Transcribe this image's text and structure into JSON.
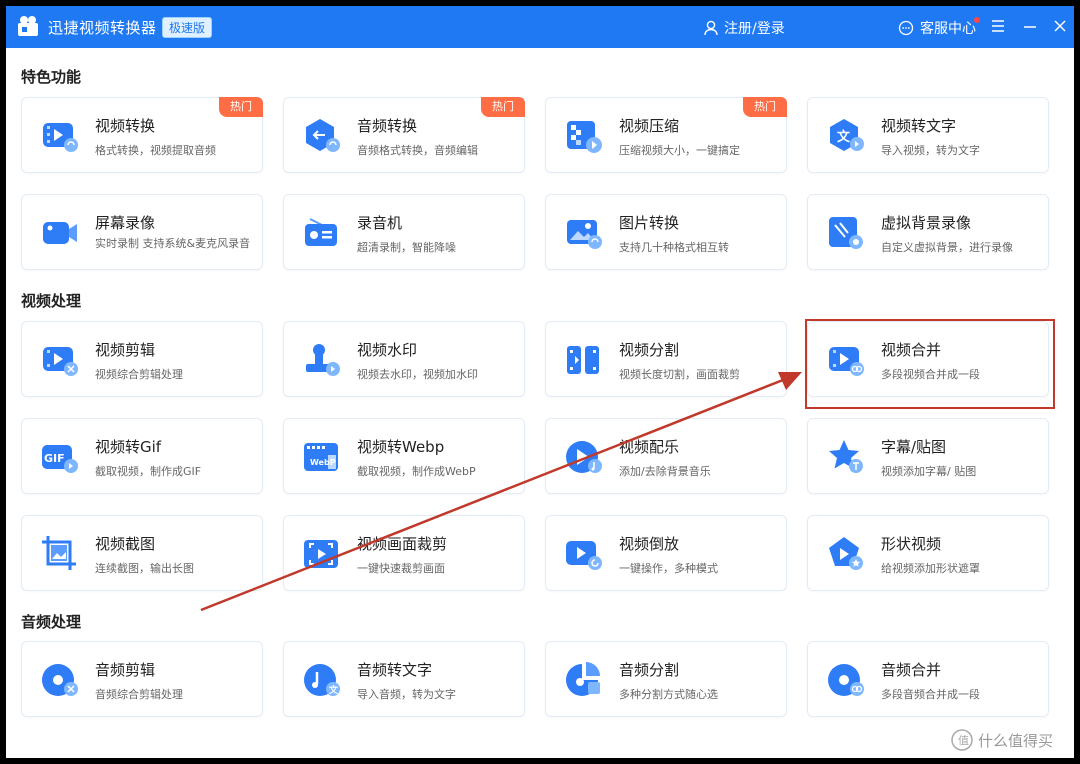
{
  "window": {
    "app_title": "迅捷视频转换器",
    "edition_badge": "极速版",
    "login_label": "注册/登录",
    "service_label": "客服中心"
  },
  "sections": [
    {
      "title": "特色功能"
    },
    {
      "title": "视频处理"
    },
    {
      "title": "音频处理"
    }
  ],
  "hot_label": "热门",
  "cards": [
    {
      "title": "视频转换",
      "subtitle": "格式转换，视频提取音频",
      "icon": "video-convert-icon"
    },
    {
      "title": "音频转换",
      "subtitle": "音频格式转换，音频编辑",
      "icon": "audio-convert-icon"
    },
    {
      "title": "视频压缩",
      "subtitle": "压缩视频大小，一键搞定",
      "icon": "video-compress-icon"
    },
    {
      "title": "视频转文字",
      "subtitle": "导入视频，转为文字",
      "icon": "video-to-text-icon"
    },
    {
      "title": "屏幕录像",
      "subtitle": "实时录制 支持系统&麦克风录音",
      "icon": "screen-record-icon"
    },
    {
      "title": "录音机",
      "subtitle": "超清录制，智能降噪",
      "icon": "recorder-icon"
    },
    {
      "title": "图片转换",
      "subtitle": "支持几十种格式相互转",
      "icon": "image-convert-icon"
    },
    {
      "title": "虚拟背景录像",
      "subtitle": "自定义虚拟背景，进行录像",
      "icon": "virtual-bg-icon"
    },
    {
      "title": "视频剪辑",
      "subtitle": "视频综合剪辑处理",
      "icon": "video-edit-icon"
    },
    {
      "title": "视频水印",
      "subtitle": "视频去水印，视频加水印",
      "icon": "watermark-icon"
    },
    {
      "title": "视频分割",
      "subtitle": "视频长度切割，画面裁剪",
      "icon": "video-split-icon"
    },
    {
      "title": "视频合并",
      "subtitle": "多段视频合并成一段",
      "icon": "video-merge-icon"
    },
    {
      "title": "视频转Gif",
      "subtitle": "截取视频，制作成GIF",
      "icon": "gif-icon",
      "icon_text": "GIF"
    },
    {
      "title": "视频转Webp",
      "subtitle": "截取视频，制作成WebP",
      "icon": "webp-icon",
      "icon_text": "WebP"
    },
    {
      "title": "视频配乐",
      "subtitle": "添加/去除背景音乐",
      "icon": "music-icon"
    },
    {
      "title": "字幕/贴图",
      "subtitle": "视频添加字幕/ 贴图",
      "icon": "subtitle-icon"
    },
    {
      "title": "视频截图",
      "subtitle": "连续截图，输出长图",
      "icon": "screenshot-icon"
    },
    {
      "title": "视频画面裁剪",
      "subtitle": "一键快速裁剪画面",
      "icon": "crop-icon"
    },
    {
      "title": "视频倒放",
      "subtitle": "一键操作，多种模式",
      "icon": "reverse-icon"
    },
    {
      "title": "形状视频",
      "subtitle": "给视频添加形状遮罩",
      "icon": "shape-icon"
    },
    {
      "title": "音频剪辑",
      "subtitle": "音频综合剪辑处理",
      "icon": "audio-edit-icon"
    },
    {
      "title": "音频转文字",
      "subtitle": "导入音频，转为文字",
      "icon": "audio-to-text-icon"
    },
    {
      "title": "音频分割",
      "subtitle": "多种分割方式随心选",
      "icon": "audio-split-icon"
    },
    {
      "title": "音频合并",
      "subtitle": "多段音频合并成一段",
      "icon": "audio-merge-icon"
    }
  ],
  "watermark_text": "什么值得买",
  "colors": {
    "brand_blue": "#1f79f2",
    "hot_orange": "#ff6d45",
    "annotation_red": "#c0392b"
  }
}
